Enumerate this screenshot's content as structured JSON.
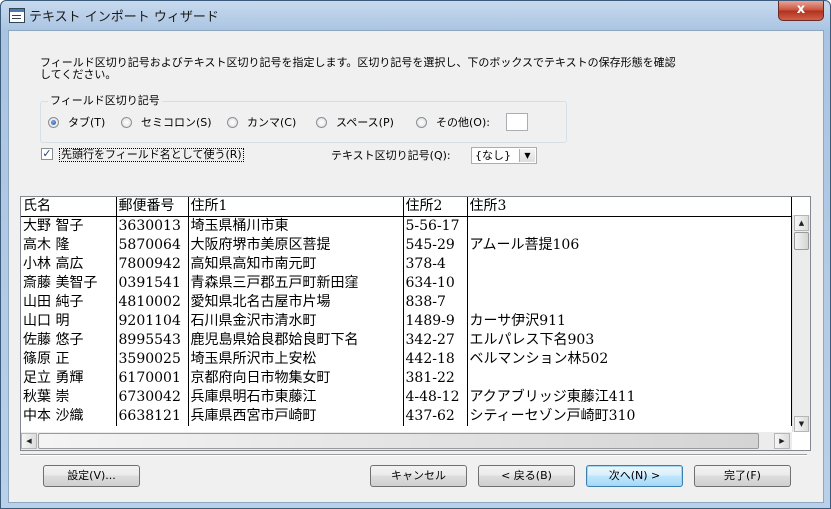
{
  "window": {
    "title": "テキスト インポート ウィザード",
    "close_glyph": "x"
  },
  "instructions": "フィールド区切り記号およびテキスト区切り記号を指定します。区切り記号を選択し、下のボックスでテキストの保存形態を確認してください。",
  "instructions_line1": "フィールド区切り記号およびテキスト区切り記号を指定します。区切り記号を選択し、下のボックスでテキストの保存形態を確認",
  "instructions_line2": "してください。",
  "delimiter_group": {
    "label": "フィールド区切り記号",
    "options": [
      {
        "label": "タブ(T)",
        "checked": true
      },
      {
        "label": "セミコロン(S)",
        "checked": false
      },
      {
        "label": "カンマ(C)",
        "checked": false
      },
      {
        "label": "スペース(P)",
        "checked": false
      },
      {
        "label": "その他(O):",
        "checked": false
      }
    ],
    "other_value": ""
  },
  "first_row_header": {
    "label": "先頭行をフィールド名として使う(R)",
    "checked": true,
    "check_glyph": "✓"
  },
  "text_qualifier": {
    "label": "テキスト区切り記号(Q):",
    "value": "{なし}",
    "arrow_glyph": "▼"
  },
  "preview": {
    "columns": [
      "氏名",
      "郵便番号",
      "住所1",
      "住所2",
      "住所3"
    ],
    "rows": [
      [
        "大野 智子",
        "3630013",
        "埼玉県桶川市東",
        "5-56-17",
        ""
      ],
      [
        "高木 隆",
        "5870064",
        "大阪府堺市美原区菩提",
        "545-29",
        "アムール菩提106"
      ],
      [
        "小林 高広",
        "7800942",
        "高知県高知市南元町",
        "378-4",
        ""
      ],
      [
        "斎藤 美智子",
        "0391541",
        "青森県三戸郡五戸町新田窪",
        "634-10",
        ""
      ],
      [
        "山田 純子",
        "4810002",
        "愛知県北名古屋市片場",
        "838-7",
        ""
      ],
      [
        "山口 明",
        "9201104",
        "石川県金沢市清水町",
        "1489-9",
        "カーサ伊沢911"
      ],
      [
        "佐藤 悠子",
        "8995543",
        "鹿児島県姶良郡姶良町下名",
        "342-27",
        "エルパレス下名903"
      ],
      [
        "篠原 正",
        "3590025",
        "埼玉県所沢市上安松",
        "442-18",
        "ベルマンション林502"
      ],
      [
        "足立 勇輝",
        "6170001",
        "京都府向日市物集女町",
        "381-22",
        ""
      ],
      [
        "秋葉 崇",
        "6730042",
        "兵庫県明石市東藤江",
        "4-48-12",
        "アクアブリッジ東藤江411"
      ],
      [
        "中本 沙織",
        "6638121",
        "兵庫県西宮市戸崎町",
        "437-62",
        "シティーセゾン戸崎町310"
      ]
    ],
    "scroll_up_glyph": "▲",
    "scroll_down_glyph": "▼",
    "scroll_left_glyph": "◀",
    "scroll_right_glyph": "▶"
  },
  "buttons": {
    "settings": "設定(V)...",
    "cancel": "キャンセル",
    "back": "< 戻る(B)",
    "next": "次へ(N) >",
    "finish": "完了(F)"
  }
}
